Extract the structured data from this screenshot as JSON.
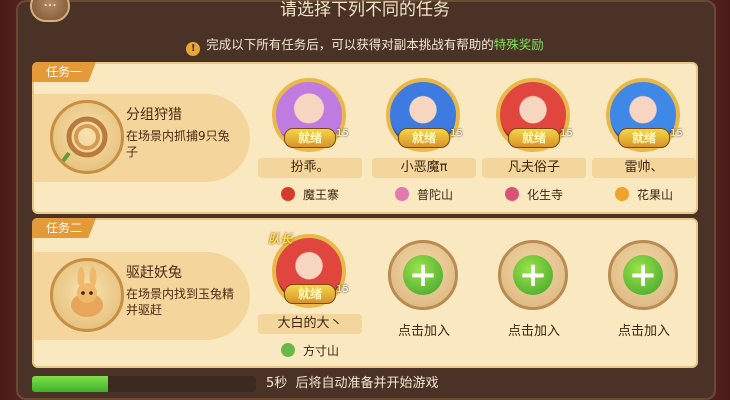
{
  "title": "请选择下列不同的任务",
  "notice": {
    "prefix": "完成以下所有任务后，可以获得对副本挑战有帮助的",
    "highlight": "特殊奖励",
    "info_icon": "info-icon",
    "highlight_color": "#7ee25a"
  },
  "tasks": [
    {
      "label": "任务一",
      "name": "分组狩猎",
      "desc": "在场景内抓捕9只兔子",
      "icon": "rope-icon",
      "slots": [
        {
          "type": "player",
          "name": "扮乖。",
          "status": "就绪",
          "level": "15",
          "school": "魔王寨",
          "color": "purple"
        },
        {
          "type": "player",
          "name": "小恶魔π",
          "status": "就绪",
          "level": "15",
          "school": "普陀山",
          "color": "blue"
        },
        {
          "type": "player",
          "name": "凡夫俗子",
          "status": "就绪",
          "level": "15",
          "school": "化生寺",
          "color": "red"
        },
        {
          "type": "player",
          "name": "雷帅、",
          "status": "就绪",
          "level": "15",
          "school": "花果山",
          "color": "blue"
        }
      ]
    },
    {
      "label": "任务二",
      "name": "驱赶妖兔",
      "desc": "在场景内找到玉兔精并驱赶",
      "icon": "rabbit-icon",
      "slots": [
        {
          "type": "player",
          "leader": "队长",
          "name": "大白的大丶",
          "status": "就绪",
          "level": "15",
          "school": "方寸山",
          "color": "red"
        },
        {
          "type": "empty",
          "label": "点击加入"
        },
        {
          "type": "empty",
          "label": "点击加入"
        },
        {
          "type": "empty",
          "label": "点击加入"
        }
      ]
    }
  ],
  "countdown": {
    "seconds": "5秒",
    "text": "后将自动准备并开始游戏",
    "progress": 0.34
  }
}
